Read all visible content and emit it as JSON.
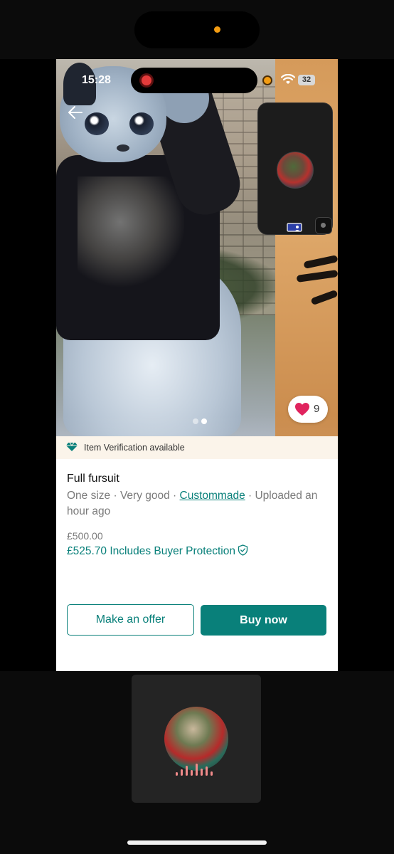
{
  "status_bar": {
    "time": "15:28",
    "battery": "32"
  },
  "listing": {
    "likes": "9",
    "verification": "Item Verification available",
    "title": "Full fursuit",
    "meta_prefix": "One size · Very good · ",
    "meta_link": "Custommade",
    "meta_suffix": " · Uploaded an hour ago",
    "price": "£500.00",
    "price_with_protection": "£525.70 Includes Buyer Protection",
    "image_count": 2,
    "active_image_index": 1
  },
  "actions": {
    "offer": "Make an offer",
    "buy": "Buy now"
  },
  "colors": {
    "accent": "#09807a",
    "heart": "#e0245e",
    "verify_bg": "#fbf4ea"
  }
}
